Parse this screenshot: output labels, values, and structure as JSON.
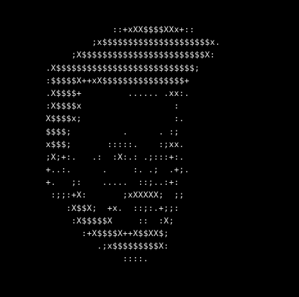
{
  "ascii_art": {
    "foreground_color": "#e8e8e8",
    "background_color": "#000000",
    "lines": [
      "              ::+xXX$$$$XXx+::",
      "          ;x$$$$$$$$$$$$$$$$$$$$$x.",
      "      ;X$$$$$$$$$$$$$$$$$$$$$$$$X:",
      " .X$$$$$$$$$$$$$$$$$$$$$$$$$$$;",
      " :$$$$$X++xX$$$$$$$$$$$$$$$$+",
      " .X$$$$+         ...... .xx:.",
      " :X$$$$x                  :",
      " X$$$$x;                  :.",
      " $$$$;          .      . :;",
      " x$$$;       :::::.    :;xx.",
      " ;X;+:.   .:  :X:.: .;:::+:.",
      " +..:.      .     :. .;  .+;.",
      " +.   ;:    .....  ::;..:+:",
      "  :;;:+X:       ;xXXXXX;  ;;",
      "     :X$$X;  +x.  ::;:.+;;:",
      "      :X$$$$$X     ::  :X;",
      "        :+X$$$$X++X$$XX$;",
      "           .;x$$$$$$$$$X:",
      "                ::::."
    ]
  }
}
